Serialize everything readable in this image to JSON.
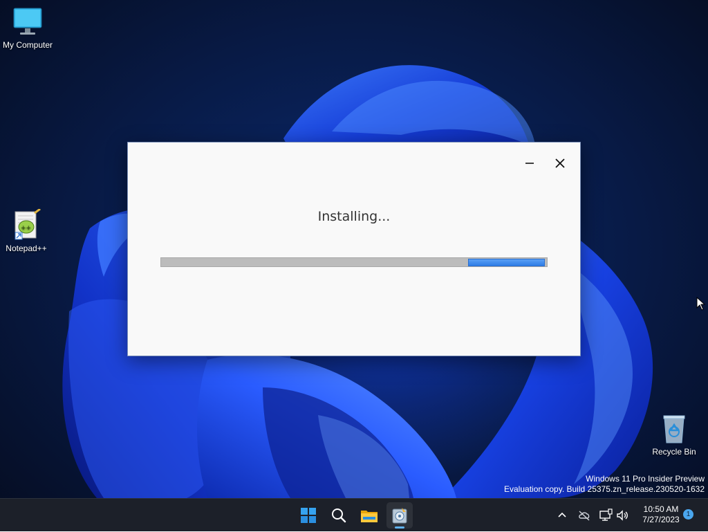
{
  "desktop": {
    "icons": [
      {
        "label": "My Computer",
        "icon": "monitor-icon"
      },
      {
        "label": "Notepad++",
        "icon": "notepad-plus-plus-icon"
      },
      {
        "label": "Recycle Bin",
        "icon": "recycle-bin-icon"
      }
    ],
    "watermark": {
      "line1": "Windows 11 Pro Insider Preview",
      "line2": "Evaluation copy. Build 25375.zn_release.230520-1632"
    }
  },
  "dialog": {
    "status": "Installing...",
    "progress": {
      "chunk_start_fraction": 0.795,
      "chunk_end_fraction": 0.995
    },
    "controls": [
      "minimize-icon",
      "close-icon"
    ]
  },
  "taskbar": {
    "apps": [
      "windows-start-icon",
      "search-icon",
      "file-explorer-icon",
      "installer-icon"
    ],
    "tray": [
      "chevron-up-icon",
      "cloud-offline-icon",
      "network-icon",
      "volume-icon"
    ],
    "clock": {
      "time": "10:50 AM",
      "date": "7/27/2023"
    },
    "notification_count": "1"
  },
  "colors": {
    "accent": "#2f7de6",
    "taskbar": "#1c2029",
    "dialog_bg": "#f9f9f9",
    "progress_track": "#bcbcbc"
  }
}
